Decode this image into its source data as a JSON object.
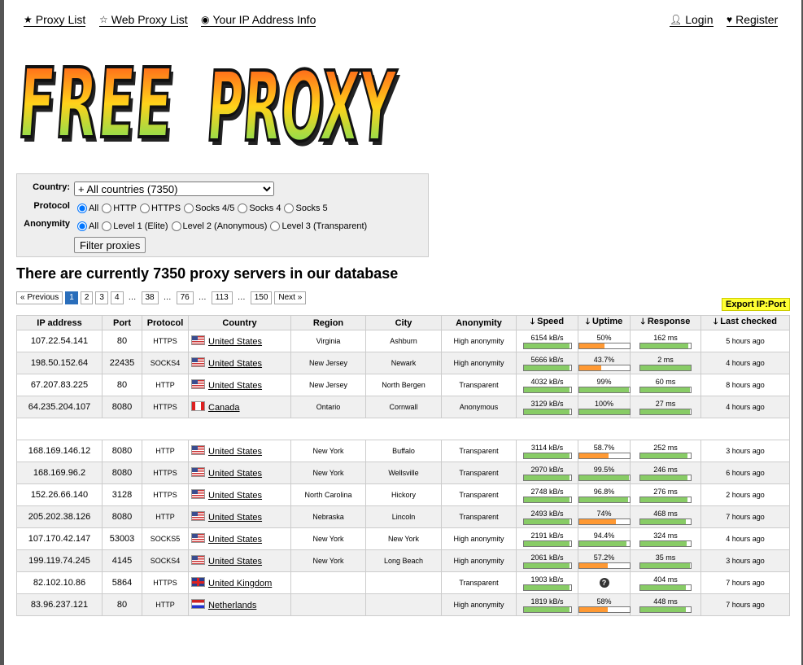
{
  "nav": {
    "proxy_list": "Proxy List",
    "web_proxy_list": "Web Proxy List",
    "ip_info": "Your IP Address Info",
    "login": "Login",
    "register": "Register"
  },
  "logo_text": "FREE PROXY",
  "filter": {
    "country_label": "Country:",
    "country_value": "+ All countries (7350)",
    "protocol_label": "Protocol",
    "protocols": [
      "All",
      "HTTP",
      "HTTPS",
      "Socks 4/5",
      "Socks 4",
      "Socks 5"
    ],
    "anonymity_label": "Anonymity",
    "anonymity": [
      "All",
      "Level 1 (Elite)",
      "Level 2 (Anonymous)",
      "Level 3 (Transparent)"
    ],
    "button": "Filter proxies"
  },
  "heading": "There are currently 7350 proxy servers in our database",
  "pager": [
    "« Previous",
    "1",
    "2",
    "3",
    "4",
    "…",
    "38",
    "…",
    "76",
    "…",
    "113",
    "…",
    "150",
    "Next »"
  ],
  "export": "Export IP:Port",
  "columns": [
    "IP address",
    "Port",
    "Protocol",
    "Country",
    "Region",
    "City",
    "Anonymity",
    "Speed",
    "Uptime",
    "Response",
    "Last checked"
  ],
  "colors": {
    "bar_green": "#88cc66",
    "bar_orange": "#ff9933",
    "active_page": "#2a6ebb",
    "export_bg": "#ffff33"
  },
  "rows_top": [
    {
      "ip": "107.22.54.141",
      "port": "80",
      "proto": "HTTPS",
      "flag": "us",
      "country": "United States",
      "region": "Virginia",
      "city": "Ashburn",
      "anon": "High anonymity",
      "speed": "6154 kB/s",
      "speed_pct": 0.98,
      "uptime": "50%",
      "uptime_pct": 0.5,
      "uptime_color": "orange",
      "resp": "162 ms",
      "resp_pct": 0.95,
      "checked": "5 hours ago"
    },
    {
      "ip": "198.50.152.64",
      "port": "22435",
      "proto": "SOCKS4",
      "flag": "us",
      "country": "United States",
      "region": "New Jersey",
      "city": "Newark",
      "anon": "High anonymity",
      "speed": "5666 kB/s",
      "speed_pct": 0.98,
      "uptime": "43.7%",
      "uptime_pct": 0.437,
      "uptime_color": "orange",
      "resp": "2 ms",
      "resp_pct": 1.0,
      "checked": "4 hours ago"
    },
    {
      "ip": "67.207.83.225",
      "port": "80",
      "proto": "HTTP",
      "flag": "us",
      "country": "United States",
      "region": "New Jersey",
      "city": "North Bergen",
      "anon": "Transparent",
      "speed": "4032 kB/s",
      "speed_pct": 0.98,
      "uptime": "99%",
      "uptime_pct": 0.99,
      "uptime_color": "green",
      "resp": "60 ms",
      "resp_pct": 0.98,
      "checked": "8 hours ago"
    },
    {
      "ip": "64.235.204.107",
      "port": "8080",
      "proto": "HTTPS",
      "flag": "ca",
      "country": "Canada",
      "region": "Ontario",
      "city": "Cornwall",
      "anon": "Anonymous",
      "speed": "3129 kB/s",
      "speed_pct": 0.98,
      "uptime": "100%",
      "uptime_pct": 1.0,
      "uptime_color": "green",
      "resp": "27 ms",
      "resp_pct": 0.99,
      "checked": "4 hours ago"
    }
  ],
  "rows_bottom": [
    {
      "ip": "168.169.146.12",
      "port": "8080",
      "proto": "HTTP",
      "flag": "us",
      "country": "United States",
      "region": "New York",
      "city": "Buffalo",
      "anon": "Transparent",
      "speed": "3114 kB/s",
      "speed_pct": 0.98,
      "uptime": "58.7%",
      "uptime_pct": 0.587,
      "uptime_color": "orange",
      "resp": "252 ms",
      "resp_pct": 0.93,
      "checked": "3 hours ago"
    },
    {
      "ip": "168.169.96.2",
      "port": "8080",
      "proto": "HTTPS",
      "flag": "us",
      "country": "United States",
      "region": "New York",
      "city": "Wellsville",
      "anon": "Transparent",
      "speed": "2970 kB/s",
      "speed_pct": 0.98,
      "uptime": "99.5%",
      "uptime_pct": 0.995,
      "uptime_color": "green",
      "resp": "246 ms",
      "resp_pct": 0.93,
      "checked": "6 hours ago"
    },
    {
      "ip": "152.26.66.140",
      "port": "3128",
      "proto": "HTTPS",
      "flag": "us",
      "country": "United States",
      "region": "North Carolina",
      "city": "Hickory",
      "anon": "Transparent",
      "speed": "2748 kB/s",
      "speed_pct": 0.98,
      "uptime": "96.8%",
      "uptime_pct": 0.968,
      "uptime_color": "green",
      "resp": "276 ms",
      "resp_pct": 0.93,
      "checked": "2 hours ago"
    },
    {
      "ip": "205.202.38.126",
      "port": "8080",
      "proto": "HTTP",
      "flag": "us",
      "country": "United States",
      "region": "Nebraska",
      "city": "Lincoln",
      "anon": "Transparent",
      "speed": "2493 kB/s",
      "speed_pct": 0.98,
      "uptime": "74%",
      "uptime_pct": 0.74,
      "uptime_color": "orange",
      "resp": "468 ms",
      "resp_pct": 0.9,
      "checked": "7 hours ago"
    },
    {
      "ip": "107.170.42.147",
      "port": "53003",
      "proto": "SOCKS5",
      "flag": "us",
      "country": "United States",
      "region": "New York",
      "city": "New York",
      "anon": "High anonymity",
      "speed": "2191 kB/s",
      "speed_pct": 0.98,
      "uptime": "94.4%",
      "uptime_pct": 0.944,
      "uptime_color": "green",
      "resp": "324 ms",
      "resp_pct": 0.92,
      "checked": "4 hours ago"
    },
    {
      "ip": "199.119.74.245",
      "port": "4145",
      "proto": "SOCKS4",
      "flag": "us",
      "country": "United States",
      "region": "New York",
      "city": "Long Beach",
      "anon": "High anonymity",
      "speed": "2061 kB/s",
      "speed_pct": 0.98,
      "uptime": "57.2%",
      "uptime_pct": 0.572,
      "uptime_color": "orange",
      "resp": "35 ms",
      "resp_pct": 0.99,
      "checked": "3 hours ago"
    },
    {
      "ip": "82.102.10.86",
      "port": "5864",
      "proto": "HTTPS",
      "flag": "gb",
      "country": "United Kingdom",
      "region": "",
      "city": "",
      "anon": "Transparent",
      "speed": "1903 kB/s",
      "speed_pct": 0.98,
      "uptime": "",
      "uptime_pct": null,
      "uptime_color": "unknown",
      "resp": "404 ms",
      "resp_pct": 0.91,
      "checked": "7 hours ago"
    },
    {
      "ip": "83.96.237.121",
      "port": "80",
      "proto": "HTTP",
      "flag": "nl",
      "country": "Netherlands",
      "region": "",
      "city": "",
      "anon": "High anonymity",
      "speed": "1819 kB/s",
      "speed_pct": 0.98,
      "uptime": "58%",
      "uptime_pct": 0.58,
      "uptime_color": "orange",
      "resp": "448 ms",
      "resp_pct": 0.9,
      "checked": "7 hours ago"
    }
  ]
}
